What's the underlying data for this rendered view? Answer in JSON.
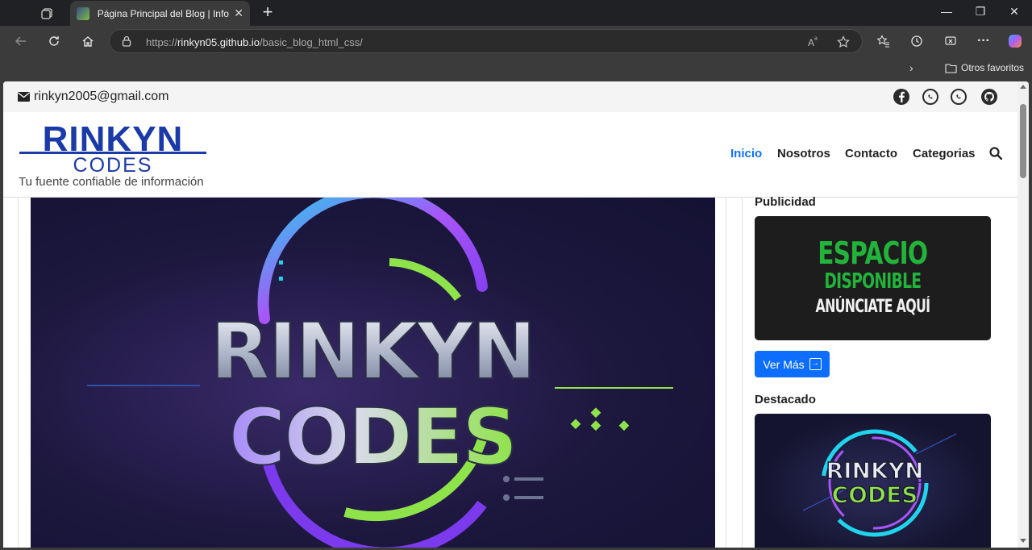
{
  "browser": {
    "tab_title": "Página Principal del Blog | Informa",
    "url_prefix": "https://",
    "url_host": "rinkyn05.github.io",
    "url_path": "/basic_blog_html_css/",
    "favorites_folder": "Otros favoritos"
  },
  "site": {
    "email": "rinkyn2005@gmail.com",
    "logo_line1": "RINKYN",
    "logo_line2": "CODES",
    "tagline": "Tu fuente confiable de información",
    "nav": [
      "Inicio",
      "Nosotros",
      "Contacto",
      "Categorias"
    ],
    "active_nav": "Inicio",
    "accent_color": "#0d6efd"
  },
  "hero": {
    "logo_line1": "RINKYN",
    "logo_line2": "CODES"
  },
  "sidebar": {
    "ad_title": "Publicidad",
    "ad_line1": "ESPACIO",
    "ad_line2": "DISPONIBLE",
    "ad_line3": "ANÚNCIATE AQUÍ",
    "more_button": "Ver Más",
    "featured_title": "Destacado",
    "featured_line1": "RINKYN",
    "featured_line2": "CODES"
  },
  "icons": [
    "tab-actions-icon",
    "close-icon",
    "plus-icon",
    "back-icon",
    "refresh-icon",
    "home-icon",
    "lock-icon",
    "read-aloud-icon",
    "star-icon",
    "favorites-icon",
    "history-icon",
    "screenshot-icon",
    "more-icon",
    "copilot-icon",
    "envelope-icon",
    "facebook-icon",
    "whatsapp-icon",
    "github-icon",
    "search-icon",
    "arrow-right-icon"
  ]
}
